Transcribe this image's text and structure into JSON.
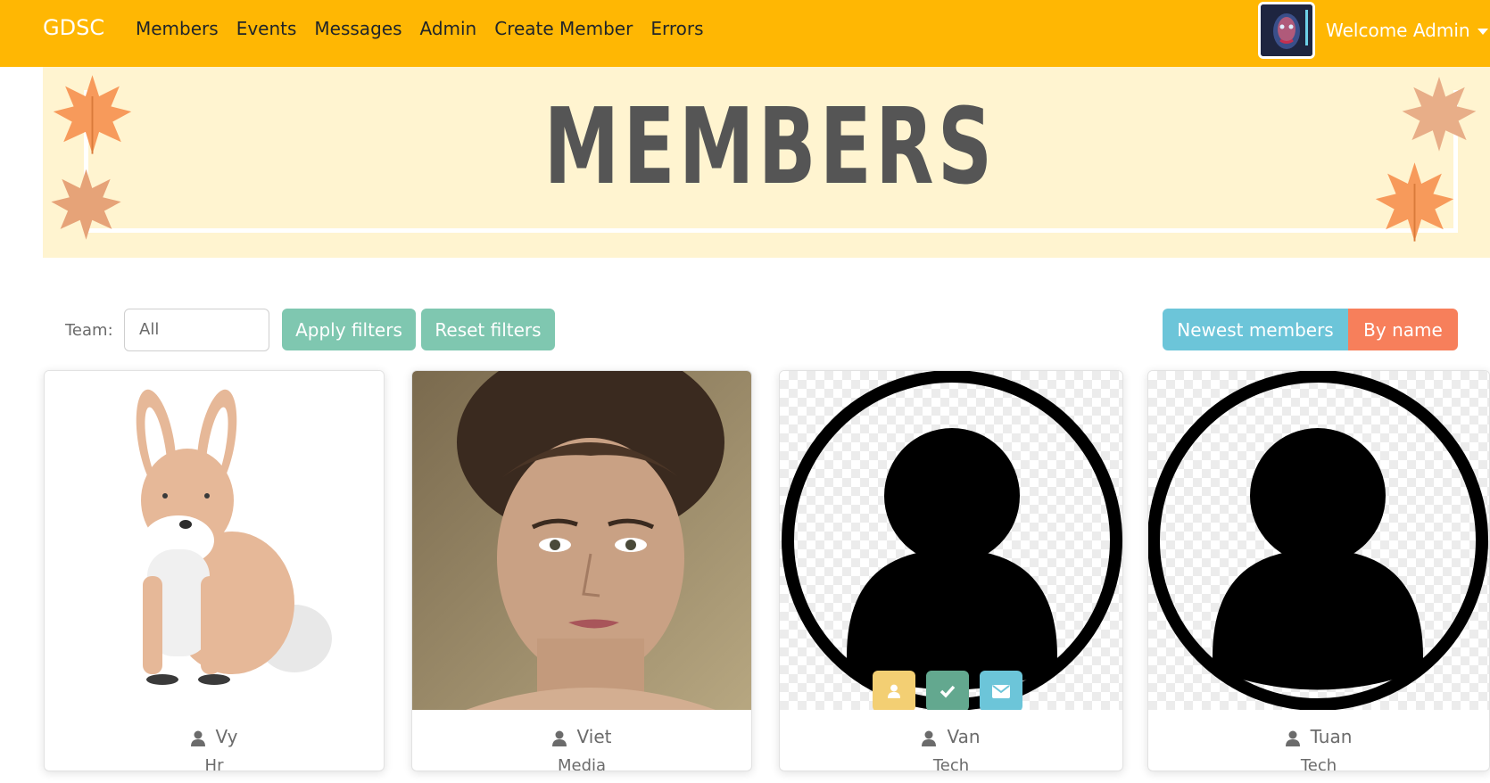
{
  "navbar": {
    "brand": "GDSC",
    "links": [
      "Members",
      "Events",
      "Messages",
      "Admin",
      "Create Member",
      "Errors"
    ],
    "welcome": "Welcome Admin"
  },
  "banner": {
    "title": "MEMBERS"
  },
  "filters": {
    "team_label": "Team:",
    "team_value": "All",
    "apply_label": "Apply filters",
    "reset_label": "Reset filters",
    "sort_newest_label": "Newest members",
    "sort_name_label": "By name"
  },
  "members": [
    {
      "name": "Vy",
      "team": "Hr",
      "image": "rabbit-illustration"
    },
    {
      "name": "Viet",
      "team": "Media",
      "image": "portrait-photo"
    },
    {
      "name": "Van",
      "team": "Tech",
      "image": "default-avatar"
    },
    {
      "name": "Tuan",
      "team": "Tech",
      "image": "default-avatar"
    }
  ],
  "colors": {
    "navbar": "#ffb703",
    "banner_bg": "#fff4d0",
    "teal_button": "#7fc7b0",
    "blue_button": "#6cc5d9",
    "orange_button": "#f77f5b"
  }
}
